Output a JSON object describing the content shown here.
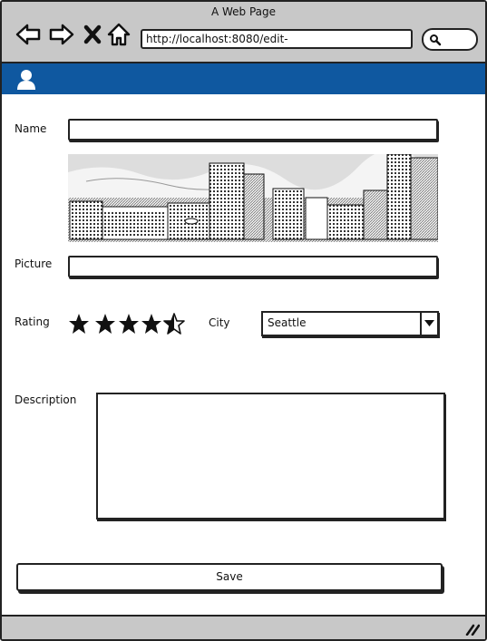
{
  "window": {
    "title": "A Web Page"
  },
  "browser": {
    "url": "http://localhost:8080/edit-",
    "icons": [
      "back-arrow-icon",
      "forward-arrow-icon",
      "close-x-icon",
      "home-icon",
      "search-icon"
    ]
  },
  "appbar": {
    "color": "#0f58a0",
    "icon": "user-icon"
  },
  "form": {
    "name_label": "Name",
    "name_value": "",
    "picture_label": "Picture",
    "picture_value": "",
    "rating_label": "Rating",
    "rating_value": 4.5,
    "rating_max": 5,
    "city_label": "City",
    "city_selected": "Seattle",
    "description_label": "Description",
    "description_value": "",
    "save_label": "Save"
  },
  "colors": {
    "chrome": "#c8c8c8",
    "accent": "#0f58a0",
    "ink": "#222222"
  }
}
